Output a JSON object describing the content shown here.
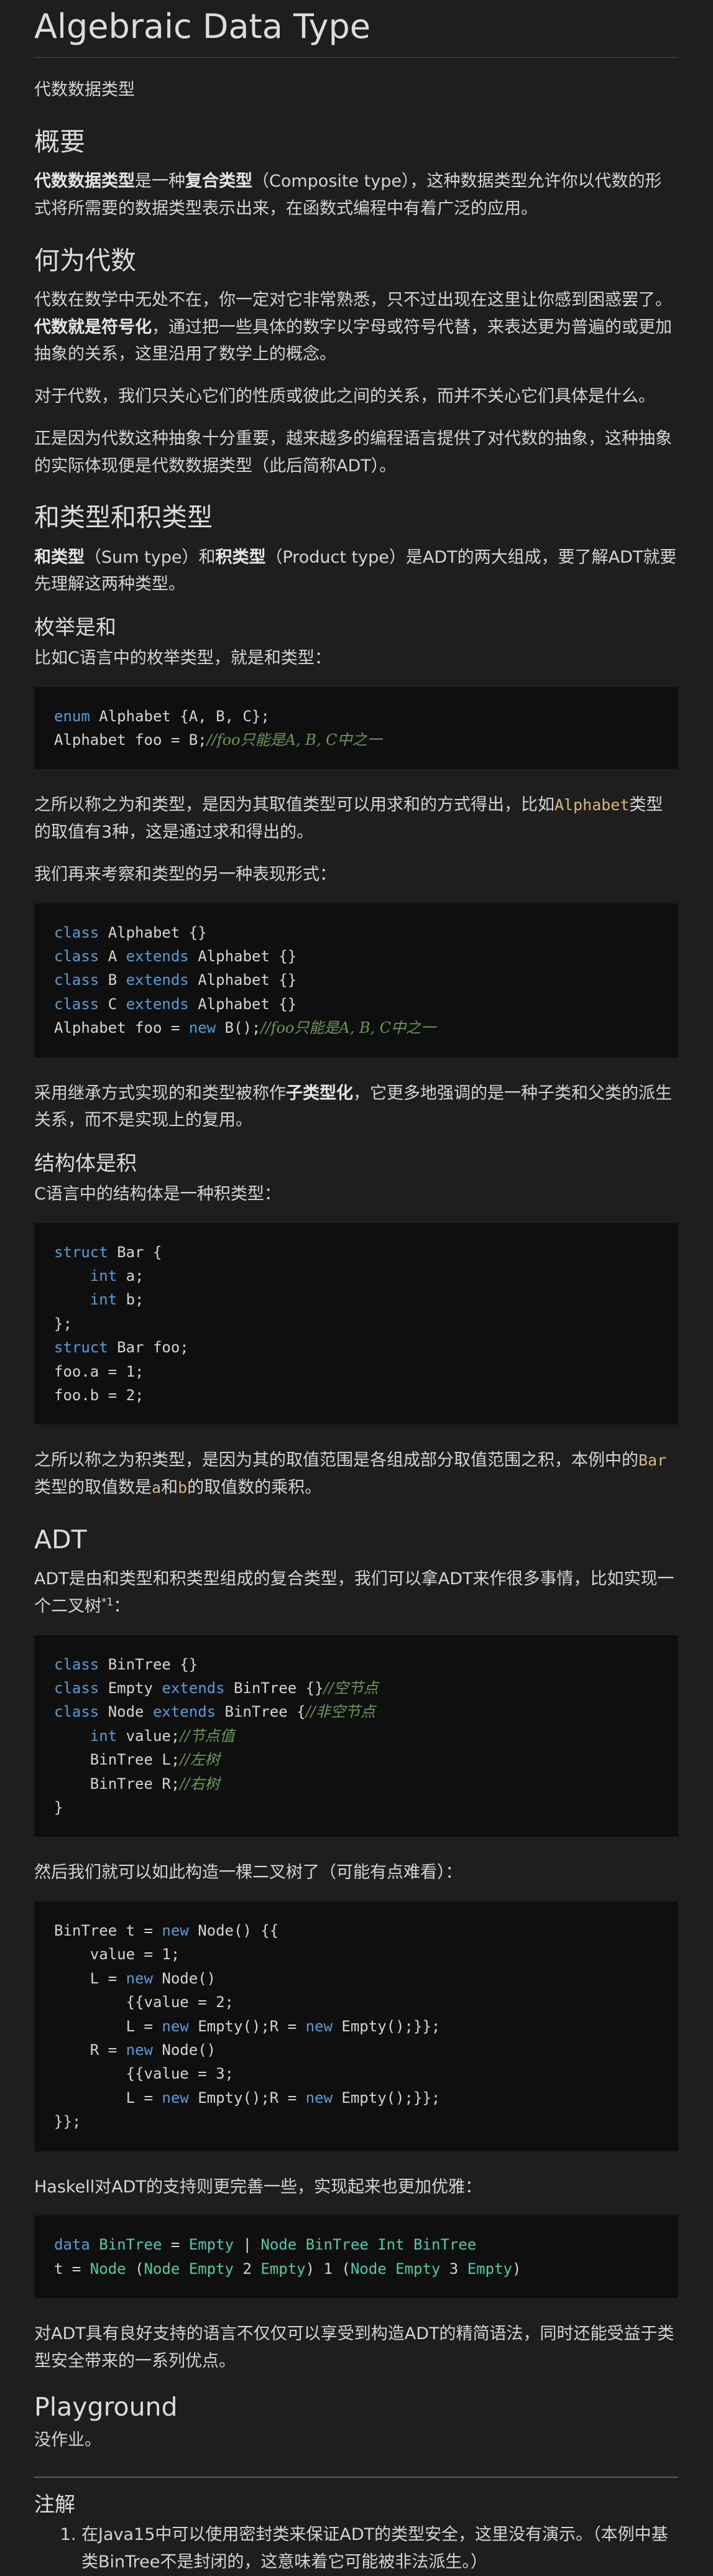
{
  "title": "Algebraic Data Type",
  "subtitle": "代数数据类型",
  "overview": {
    "heading": "概要",
    "p1_b1": "代数数据类型",
    "p1_t1": "是一种",
    "p1_b2": "复合类型",
    "p1_t2": "（Composite type），这种数据类型允许你以代数的形式将所需要的数据类型表示出来，在函数式编程中有着广泛的应用。"
  },
  "why": {
    "heading": "何为代数",
    "p1_t1": "代数在数学中无处不在，你一定对它非常熟悉，只不过出现在这里让你感到困惑罢了。",
    "p1_b1": "代数就是符号化",
    "p1_t2": "，通过把一些具体的数字以字母或符号代替，来表达更为普遍的或更加抽象的关系，这里沿用了数学上的概念。",
    "p2": "对于代数，我们只关心它们的性质或彼此之间的关系，而并不关心它们具体是什么。",
    "p3": "正是因为代数这种抽象十分重要，越来越多的编程语言提供了对代数的抽象，这种抽象的实际体现便是代数数据类型（此后简称ADT）。"
  },
  "sumprod": {
    "heading": "和类型和积类型",
    "b1": "和类型",
    "t1": "（Sum type）和",
    "b2": "积类型",
    "t2": "（Product type）是ADT的两大组成，要了解ADT就要先理解这两种类型。"
  },
  "enum": {
    "heading": "枚举是和",
    "intro": "比如C语言中的枚举类型，就是和类型：",
    "after_t1": "之所以称之为和类型，是因为其取值类型可以用求和的方式得出，比如",
    "after_code": "Alphabet",
    "after_t2": "类型的取值有3种，这是通过求和得出的。",
    "other_form": "我们再来考察和类型的另一种表现形式：",
    "inherit_t1": "采用继承方式实现的和类型被称作",
    "inherit_b": "子类型化",
    "inherit_t2": "，它更多地强调的是一种子类和父类的派生关系，而不是实现上的复用。"
  },
  "struct": {
    "heading": "结构体是积",
    "intro": "C语言中的结构体是一种积类型：",
    "after_t1": "之所以称之为积类型，是因为其的取值范围是各组成部分取值范围之积，本例中的",
    "after_code1": "Bar",
    "after_t2": "类型的取值数是",
    "after_code2": "a",
    "after_t3": "和",
    "after_code3": "b",
    "after_t4": "的取值数的乘积。"
  },
  "adt": {
    "heading": "ADT",
    "intro": "ADT是由和类型和积类型组成的复合类型，我们可以拿ADT来作很多事情，比如实现一个二叉树",
    "footnote_ref": "*1",
    "intro_end": "：",
    "construct": "然后我们就可以如此构造一棵二叉树了（可能有点难看）：",
    "haskell": "Haskell对ADT的支持则更完善一些，实现起来也更加优雅：",
    "benefit": "对ADT具有良好支持的语言不仅仅可以享受到构造ADT的精简语法，同时还能受益于类型安全带来的一系列优点。"
  },
  "playground": {
    "heading": "Playground",
    "text": "没作业。"
  },
  "notes": {
    "heading": "注解",
    "items": [
      "在Java15中可以使用密封类来保证ADT的类型安全，这里没有演示。（本例中基类BinTree不是封闭的，这意味着它可能被非法派生。）"
    ]
  },
  "code": {
    "enum": [
      [
        {
          "t": "enum",
          "c": "kw"
        },
        {
          "t": " Alphabet {A, B, C};"
        }
      ],
      [
        {
          "t": "Alphabet foo = B;"
        },
        {
          "t": "//foo只能是A, B, C中之一",
          "c": "cm"
        }
      ]
    ],
    "classes": [
      [
        {
          "t": "class",
          "c": "kw"
        },
        {
          "t": " Alphabet {}"
        }
      ],
      [
        {
          "t": "class",
          "c": "kw"
        },
        {
          "t": " A "
        },
        {
          "t": "extends",
          "c": "kw"
        },
        {
          "t": " Alphabet {}"
        }
      ],
      [
        {
          "t": "class",
          "c": "kw"
        },
        {
          "t": " B "
        },
        {
          "t": "extends",
          "c": "kw"
        },
        {
          "t": " Alphabet {}"
        }
      ],
      [
        {
          "t": "class",
          "c": "kw"
        },
        {
          "t": " C "
        },
        {
          "t": "extends",
          "c": "kw"
        },
        {
          "t": " Alphabet {}"
        }
      ],
      [
        {
          "t": "Alphabet foo = "
        },
        {
          "t": "new",
          "c": "kw"
        },
        {
          "t": " B();"
        },
        {
          "t": "//foo只能是A, B, C中之一",
          "c": "cm"
        }
      ]
    ],
    "struct": [
      [
        {
          "t": "struct",
          "c": "kw"
        },
        {
          "t": " Bar {"
        }
      ],
      [
        {
          "t": "    "
        },
        {
          "t": "int",
          "c": "kw"
        },
        {
          "t": " a;"
        }
      ],
      [
        {
          "t": "    "
        },
        {
          "t": "int",
          "c": "kw"
        },
        {
          "t": " b;"
        }
      ],
      [
        {
          "t": "};"
        }
      ],
      [
        {
          "t": "struct",
          "c": "kw"
        },
        {
          "t": " Bar foo;"
        }
      ],
      [
        {
          "t": "foo.a = 1;"
        }
      ],
      [
        {
          "t": "foo.b = 2;"
        }
      ]
    ],
    "bintree": [
      [
        {
          "t": "class",
          "c": "kw"
        },
        {
          "t": " BinTree {}"
        }
      ],
      [
        {
          "t": "class",
          "c": "kw"
        },
        {
          "t": " Empty "
        },
        {
          "t": "extends",
          "c": "kw"
        },
        {
          "t": " BinTree {}"
        },
        {
          "t": "//空节点",
          "c": "cm"
        }
      ],
      [
        {
          "t": "class",
          "c": "kw"
        },
        {
          "t": " Node "
        },
        {
          "t": "extends",
          "c": "kw"
        },
        {
          "t": " BinTree {"
        },
        {
          "t": "//非空节点",
          "c": "cm"
        }
      ],
      [
        {
          "t": "    "
        },
        {
          "t": "int",
          "c": "kw"
        },
        {
          "t": " value;"
        },
        {
          "t": "//节点值",
          "c": "cm"
        }
      ],
      [
        {
          "t": "    BinTree L;"
        },
        {
          "t": "//左树",
          "c": "cm"
        }
      ],
      [
        {
          "t": "    BinTree R;"
        },
        {
          "t": "//右树",
          "c": "cm"
        }
      ],
      [
        {
          "t": "}"
        }
      ]
    ],
    "construct": [
      [
        {
          "t": "BinTree t = "
        },
        {
          "t": "new",
          "c": "kw"
        },
        {
          "t": " Node() {{"
        }
      ],
      [
        {
          "t": "    value = 1;"
        }
      ],
      [
        {
          "t": "    L = "
        },
        {
          "t": "new",
          "c": "kw"
        },
        {
          "t": " Node()"
        }
      ],
      [
        {
          "t": "        {{value = 2;"
        }
      ],
      [
        {
          "t": "        L = "
        },
        {
          "t": "new",
          "c": "kw"
        },
        {
          "t": " Empty();R = "
        },
        {
          "t": "new",
          "c": "kw"
        },
        {
          "t": " Empty();}};"
        }
      ],
      [
        {
          "t": "    R = "
        },
        {
          "t": "new",
          "c": "kw"
        },
        {
          "t": " Node()"
        }
      ],
      [
        {
          "t": "        {{value = 3;"
        }
      ],
      [
        {
          "t": "        L = "
        },
        {
          "t": "new",
          "c": "kw"
        },
        {
          "t": " Empty();R = "
        },
        {
          "t": "new",
          "c": "kw"
        },
        {
          "t": " Empty();}};"
        }
      ],
      [
        {
          "t": "}};"
        }
      ]
    ],
    "haskell": [
      [
        {
          "t": "data",
          "c": "kw"
        },
        {
          "t": " "
        },
        {
          "t": "BinTree",
          "c": "ty"
        },
        {
          "t": " = "
        },
        {
          "t": "Empty",
          "c": "ty"
        },
        {
          "t": " | "
        },
        {
          "t": "Node",
          "c": "ty"
        },
        {
          "t": " "
        },
        {
          "t": "BinTree",
          "c": "ty"
        },
        {
          "t": " "
        },
        {
          "t": "Int",
          "c": "ty"
        },
        {
          "t": " "
        },
        {
          "t": "BinTree",
          "c": "ty"
        }
      ],
      [
        {
          "t": "t = "
        },
        {
          "t": "Node",
          "c": "ty"
        },
        {
          "t": " ("
        },
        {
          "t": "Node",
          "c": "ty"
        },
        {
          "t": " "
        },
        {
          "t": "Empty",
          "c": "ty"
        },
        {
          "t": " 2 "
        },
        {
          "t": "Empty",
          "c": "ty"
        },
        {
          "t": ") 1 ("
        },
        {
          "t": "Node",
          "c": "ty"
        },
        {
          "t": " "
        },
        {
          "t": "Empty",
          "c": "ty"
        },
        {
          "t": " 3 "
        },
        {
          "t": "Empty",
          "c": "ty"
        },
        {
          "t": ")"
        }
      ]
    ]
  }
}
